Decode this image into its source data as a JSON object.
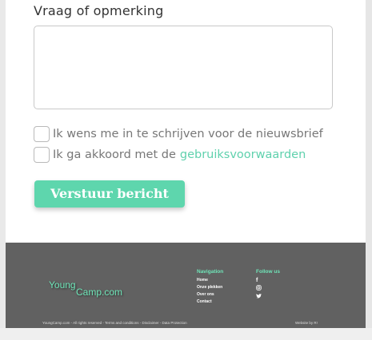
{
  "form": {
    "question_label": "Vraag of opmerking",
    "newsletter_label": "Ik wens me in te schrijven voor de nieuwsbrief",
    "terms_prefix": "Ik ga akkoord met de",
    "terms_link": "gebruiksvoorwaarden",
    "submit_label": "Verstuur bericht"
  },
  "footer": {
    "logo_young": "Young",
    "logo_camp": "Camp.com",
    "nav_heading": "Navigation",
    "nav_items": [
      "Home",
      "Onze plekken",
      "Over ons",
      "Contact"
    ],
    "follow_heading": "Follow us",
    "social_icons": [
      "facebook-icon",
      "instagram-icon",
      "twitter-icon"
    ],
    "copyright": "YoungCamp.com - All rights reserved - Terms and conditions - Disclaimer - Data Protection",
    "credit": "Website by R!"
  },
  "colors": {
    "accent": "#5ed6ad",
    "footer_bg": "#616161"
  }
}
